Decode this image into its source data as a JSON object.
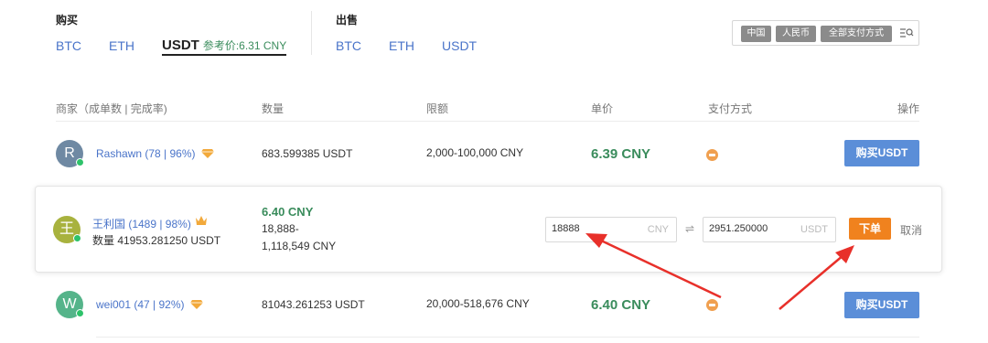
{
  "buy_section": {
    "title": "购买",
    "tabs": [
      "BTC",
      "ETH",
      "USDT"
    ],
    "ref_price": "参考价:6.31 CNY"
  },
  "sell_section": {
    "title": "出售",
    "tabs": [
      "BTC",
      "ETH",
      "USDT"
    ]
  },
  "filters": {
    "chips": [
      "中国",
      "人民币",
      "全部支付方式"
    ],
    "icon": "filter-search-icon"
  },
  "table": {
    "headers": {
      "merchant": "商家（成单数 | 完成率)",
      "amount": "数量",
      "limit": "限额",
      "price": "单价",
      "payment": "支付方式",
      "action": "操作"
    }
  },
  "rows": [
    {
      "avatar": "R",
      "avatar_color": "#6f89a3",
      "name": "Rashawn (78 | 96%)",
      "amount": "683.599385 USDT",
      "limit": "2,000-100,000 CNY",
      "price": "6.39 CNY",
      "button": "购买USDT"
    },
    {
      "avatar": "W",
      "avatar_color": "#55b48a",
      "name": "wei001 (47 | 92%)",
      "amount": "81043.261253 USDT",
      "limit": "20,000-518,676 CNY",
      "price": "6.40 CNY",
      "button": "购买USDT"
    }
  ],
  "expanded": {
    "avatar": "王",
    "avatar_color": "#a8b23e",
    "name": "王利国 (1489 | 98%)",
    "quantity": "数量 41953.281250 USDT",
    "price": "6.40 CNY",
    "limit_line1": "18,888-",
    "limit_line2": "1,118,549 CNY",
    "cny_value": "18888",
    "cny_unit": "CNY",
    "usdt_value": "2951.250000",
    "usdt_unit": "USDT",
    "swap_symbol": "⇌",
    "order_button": "下单",
    "cancel": "取消"
  },
  "colors": {
    "link": "#4a74c9",
    "price": "#3a8c5c",
    "buy_button": "#5b8ed8",
    "order_button": "#f0821e",
    "annotation": "#e8302a"
  }
}
